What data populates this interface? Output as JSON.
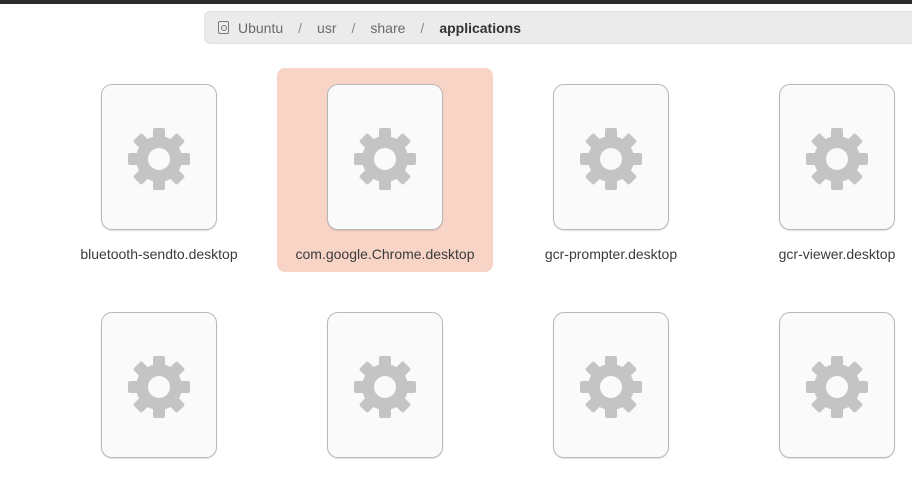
{
  "breadcrumb": {
    "items": [
      "Ubuntu",
      "usr",
      "share",
      "applications"
    ],
    "separator": "/"
  },
  "files": [
    {
      "name": "bluetooth-sendto.desktop",
      "selected": false
    },
    {
      "name": "com.google.Chrome.desktop",
      "selected": true
    },
    {
      "name": "gcr-prompter.desktop",
      "selected": false
    },
    {
      "name": "gcr-viewer.desktop",
      "selected": false
    },
    {
      "name": "",
      "selected": false
    },
    {
      "name": "",
      "selected": false
    },
    {
      "name": "",
      "selected": false
    },
    {
      "name": "",
      "selected": false
    }
  ],
  "colors": {
    "selection": "#f8d4c6",
    "gear": "#c4c4c4",
    "pathbar": "#ebebeb"
  },
  "icons": {
    "location": "drive-icon",
    "file": "settings-gear-icon"
  }
}
